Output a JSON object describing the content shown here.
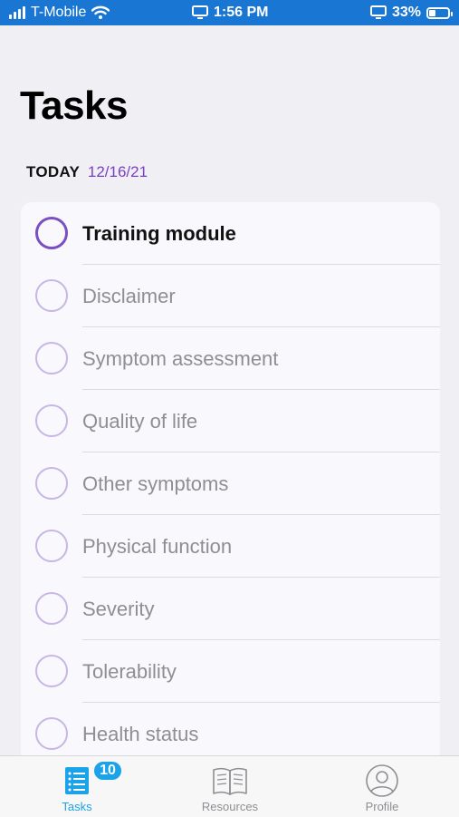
{
  "status_bar": {
    "carrier": "T-Mobile",
    "time": "1:56 PM",
    "battery": "33%",
    "battery_level": 0.33
  },
  "header": {
    "title": "Tasks",
    "day_label": "TODAY",
    "date": "12/16/21"
  },
  "tasks": [
    {
      "label": "Training module",
      "active": true
    },
    {
      "label": "Disclaimer",
      "active": false
    },
    {
      "label": "Symptom assessment",
      "active": false
    },
    {
      "label": "Quality of life",
      "active": false
    },
    {
      "label": "Other symptoms",
      "active": false
    },
    {
      "label": "Physical function",
      "active": false
    },
    {
      "label": "Severity",
      "active": false
    },
    {
      "label": "Tolerability",
      "active": false
    },
    {
      "label": "Health status",
      "active": false
    }
  ],
  "tab_bar": {
    "tasks_label": "Tasks",
    "tasks_badge": "10",
    "resources_label": "Resources",
    "profile_label": "Profile"
  },
  "colors": {
    "status_bar": "#1976d2",
    "accent_purple": "#7c3fc7",
    "tab_selected": "#1aa3e8"
  }
}
